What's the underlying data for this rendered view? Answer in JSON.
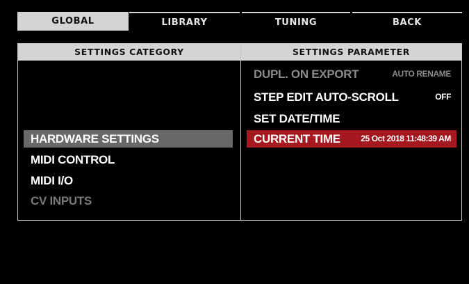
{
  "tabs": [
    {
      "label": "GLOBAL",
      "active": true
    },
    {
      "label": "LIBRARY",
      "active": false
    },
    {
      "label": "TUNING",
      "active": false
    },
    {
      "label": "BACK",
      "active": false
    }
  ],
  "category_panel": {
    "header": "SETTINGS CATEGORY",
    "items": [
      {
        "label": "HARDWARE SETTINGS",
        "selected": true
      },
      {
        "label": "MIDI CONTROL"
      },
      {
        "label": "MIDI I/O"
      },
      {
        "label": "CV INPUTS",
        "dimmed": true
      }
    ]
  },
  "parameter_panel": {
    "header": "SETTINGS PARAMETER",
    "items": [
      {
        "label": "DUPL. ON EXPORT",
        "value": "AUTO RENAME",
        "dimmed": true
      },
      {
        "label": "STEP EDIT AUTO-SCROLL",
        "value": "OFF"
      },
      {
        "label": "SET DATE/TIME",
        "value": ""
      },
      {
        "label": "CURRENT TIME",
        "value": "25 Oct 2018 11:48:39 AM",
        "highlighted": true
      }
    ]
  },
  "colors": {
    "background": "#000000",
    "tab_active_bg": "#d4d4d4",
    "header_bg": "#d4d4d4",
    "selection_bg": "#686868",
    "highlight_bg": "#a5181f"
  }
}
